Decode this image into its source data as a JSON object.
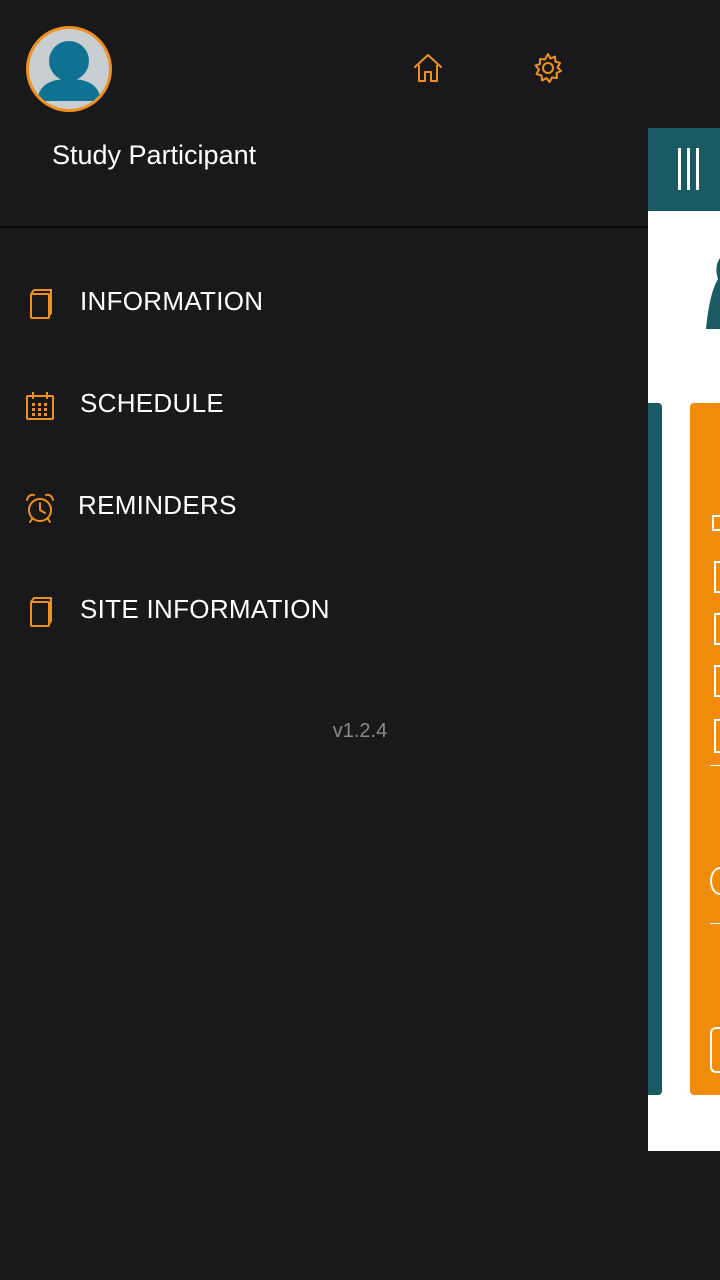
{
  "user": {
    "name": "Study Participant"
  },
  "header": {
    "home_icon": "home-icon",
    "settings_icon": "gear-icon"
  },
  "menu": [
    {
      "label": "INFORMATION",
      "icon": "book-icon"
    },
    {
      "label": "SCHEDULE",
      "icon": "calendar-icon"
    },
    {
      "label": "REMINDERS",
      "icon": "alarm-clock-icon"
    },
    {
      "label": "SITE INFORMATION",
      "icon": "book-icon"
    }
  ],
  "app": {
    "version": "v1.2.4"
  },
  "colors": {
    "accent": "#f0911e",
    "teal": "#1a5a63",
    "orange": "#f08c0a",
    "background": "#19191b"
  }
}
